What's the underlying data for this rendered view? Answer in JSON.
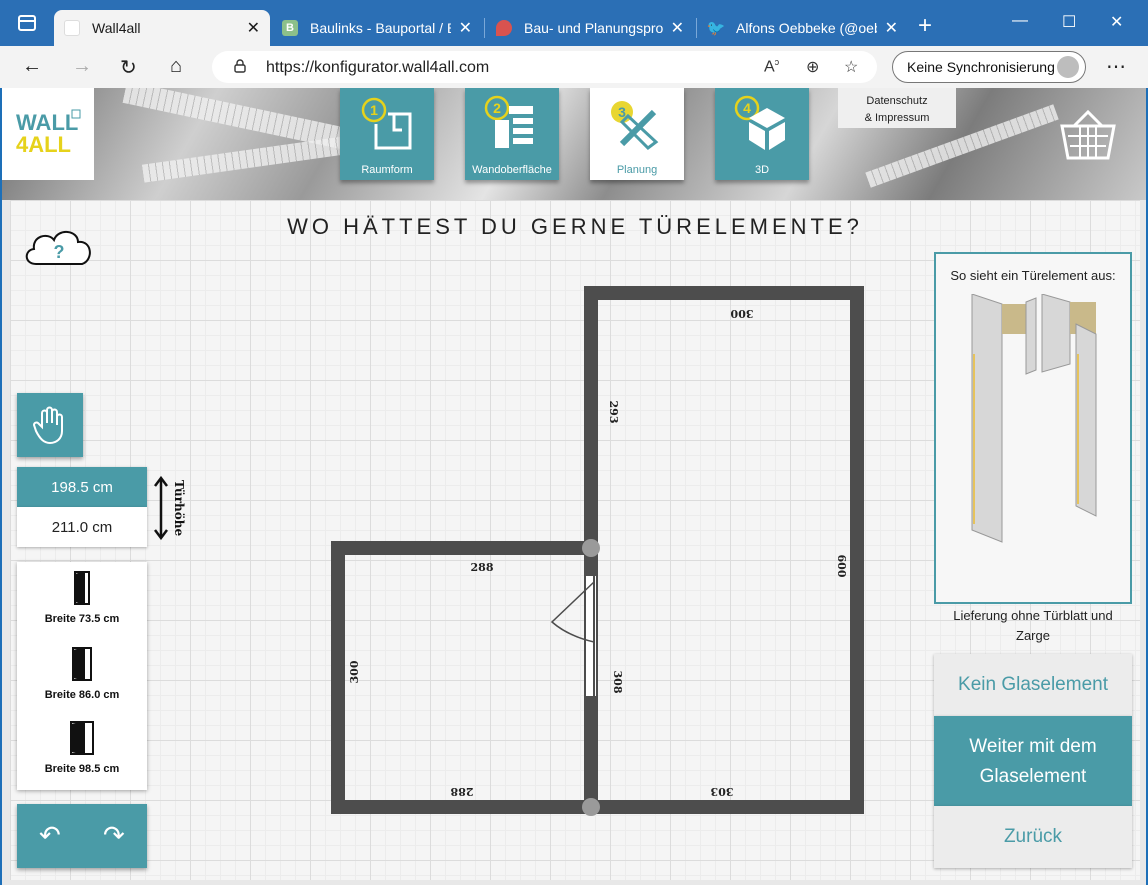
{
  "browser": {
    "tabs": [
      {
        "title": "Wall4all",
        "favicon_color": "#ffffff",
        "active": true
      },
      {
        "title": "Baulinks - Bauportal / B",
        "favicon_color": "#8cc08a",
        "favicon_text": "B",
        "active": false
      },
      {
        "title": "Bau- und Planungsproje",
        "favicon_color": "#d9534f",
        "active": false
      },
      {
        "title": "Alfons Oebbeke (@oeb",
        "favicon_color": "#1da1f2",
        "active": false
      }
    ],
    "url": "https://konfigurator.wall4all.com",
    "sync_label": "Keine Synchronisierung"
  },
  "header": {
    "logo_line1": "WALL",
    "logo_line2": "4ALL",
    "steps": [
      {
        "number": "1",
        "label": "Raumform",
        "active": false
      },
      {
        "number": "2",
        "label": "Wandoberfläche",
        "active": false
      },
      {
        "number": "3",
        "label": "Planung",
        "active": true
      },
      {
        "number": "4",
        "label": "3D",
        "active": false
      }
    ],
    "datenschutz_line1": "Datenschutz",
    "datenschutz_line2": "& Impressum"
  },
  "main": {
    "question": "WO HÄTTEST DU GERNE TÜRELEMENTE?",
    "help_symbol": "?",
    "door_heights": {
      "selected": "198.5 cm",
      "other": "211.0 cm",
      "label": "Türhöhe"
    },
    "door_widths": [
      "Breite 73.5 cm",
      "Breite 86.0 cm",
      "Breite 98.5 cm"
    ],
    "info": {
      "title": "So sieht ein Türelement aus:",
      "caption": "Lieferung ohne Türblatt und Zarge"
    },
    "actions": {
      "no_glass": "Kein Glaselement",
      "with_glass": "Weiter mit dem Glaselement",
      "back": "Zurück"
    },
    "plan_dimensions": {
      "top_right": "300",
      "middle_wall_upper": "293",
      "right_wall": "600",
      "left_room_top": "288",
      "left_wall": "300",
      "middle_wall_lower": "308",
      "bottom_left": "288",
      "bottom_right": "303"
    }
  },
  "colors": {
    "accent": "#4a9ba7",
    "wall": "#4d4d4d",
    "browser_blue": "#2b6fb5"
  }
}
